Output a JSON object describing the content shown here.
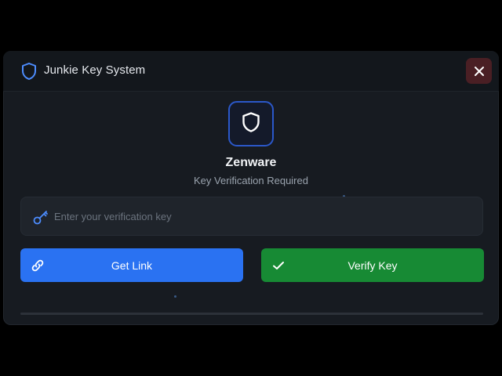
{
  "window": {
    "title": "Junkie Key System",
    "close_icon": "close-icon",
    "shield_icon": "shield-icon"
  },
  "brand": {
    "name": "Zenware",
    "subtitle": "Key Verification Required",
    "logo_icon": "shield-icon"
  },
  "key_input": {
    "placeholder": "Enter your verification key",
    "value": "",
    "icon": "key-icon"
  },
  "buttons": {
    "get_link": {
      "label": "Get Link",
      "icon": "link-icon"
    },
    "verify_key": {
      "label": "Verify Key",
      "icon": "checkmark-icon"
    }
  },
  "colors": {
    "background": "#171b21",
    "titlebar": "#13171c",
    "accent_blue": "#2a72f2",
    "accent_green": "#178a34",
    "close_bg": "#4a1f24"
  }
}
